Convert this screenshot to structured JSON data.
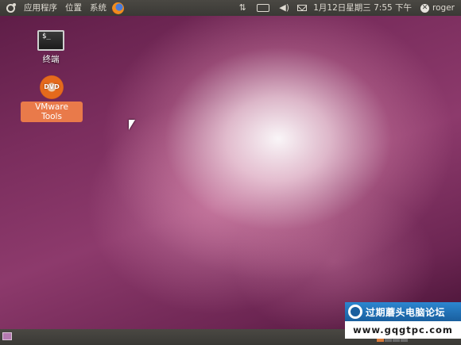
{
  "top_panel": {
    "menus": [
      "应用程序",
      "位置",
      "系统"
    ],
    "clock": "1月12日星期三 7:55 下午",
    "user": "roger",
    "icons": [
      "ubuntu-logo-icon",
      "firefox-icon",
      "network-icon",
      "keyboard-icon",
      "volume-icon",
      "mail-icon",
      "shutdown-icon"
    ]
  },
  "desktop": {
    "icons": [
      {
        "label": "终端",
        "icon": "terminal-icon",
        "glyph": "$_"
      },
      {
        "label": "VMware Tools",
        "icon": "dvd-icon",
        "glyph": "DVD",
        "selected": true
      }
    ]
  },
  "watermark": {
    "title": "过期蘑头电脑论坛",
    "url": "www.gqgtpc.com"
  }
}
